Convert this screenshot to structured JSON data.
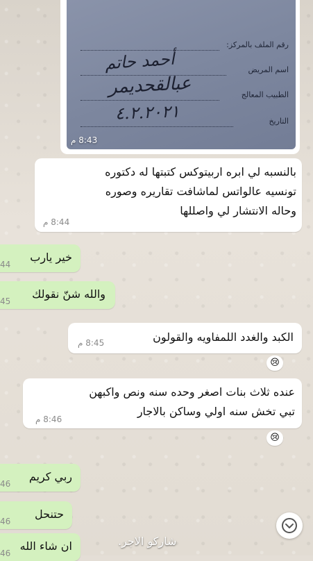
{
  "photo_message": {
    "time": "8:43 م",
    "form": {
      "file_no_label": "رقم الملف بالمركز:",
      "patient_label": "اسم المريض",
      "doctor_label": "الطبيب المعالج",
      "date_label": "التاريخ",
      "patient_value": "أحمد حاتم",
      "doctor_value": "عبالقحديمر",
      "date_value": "٤.٢.٢٠٢١"
    }
  },
  "messages": [
    {
      "direction": "in",
      "lines": [
        "بالنسبه لي ابره اربيتوكس  كتبتها له دكتوره",
        "تونسيه عالواتس  لماشافت تقاريره وصوره",
        "وحاله الانتشار لي واصللها"
      ],
      "time": "8:44 م"
    },
    {
      "direction": "out",
      "lines": [
        "خير يارب"
      ],
      "time_partial": "44"
    },
    {
      "direction": "out",
      "lines": [
        "والله شنّ نقولك"
      ],
      "time_partial": "45"
    },
    {
      "direction": "in",
      "lines": [
        "الكبد والغدد اللمفاويه والقولون"
      ],
      "time": "8:45 م",
      "reaction": "😢"
    },
    {
      "direction": "in",
      "lines": [
        "عنده ثلاث بنات اصغر وحده سنه ونص واكبهن",
        "تبي تخش سنه اولي وساكن بالاجار"
      ],
      "time": "8:46 م",
      "reaction": "😢"
    },
    {
      "direction": "out",
      "lines": [
        "ربي كريم"
      ],
      "time_partial": "46"
    },
    {
      "direction": "out",
      "lines": [
        "حتنحل"
      ],
      "time_partial": "46"
    },
    {
      "direction": "out",
      "lines": [
        "ان شاء الله"
      ],
      "time_partial": "46"
    }
  ],
  "scroll_button": {
    "icon": "chevron-down-icon"
  },
  "footer_text": "شاركو الاجر."
}
